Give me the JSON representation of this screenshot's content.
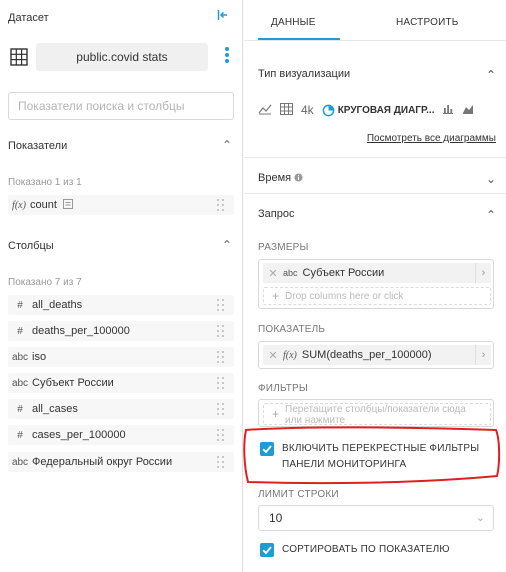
{
  "dataset": {
    "title": "Датасет",
    "name": "public.covid stats"
  },
  "search": {
    "placeholder": "Показатели поиска и столбцы"
  },
  "metrics_section": {
    "title": "Показатели",
    "count_text": "Показано 1 из 1",
    "items": [
      {
        "type": "f(x)",
        "label": "count"
      }
    ]
  },
  "columns_section": {
    "title": "Столбцы",
    "count_text": "Показано 7 из 7",
    "items": [
      {
        "type": "#",
        "label": "all_deaths"
      },
      {
        "type": "#",
        "label": "deaths_per_100000"
      },
      {
        "type": "abc",
        "label": "iso"
      },
      {
        "type": "abc",
        "label": "Субъект России"
      },
      {
        "type": "#",
        "label": "all_cases"
      },
      {
        "type": "#",
        "label": "cases_per_100000"
      },
      {
        "type": "abc",
        "label": "Федеральный округ России"
      }
    ]
  },
  "tabs": [
    {
      "label": "ДАННЫЕ",
      "active": true
    },
    {
      "label": "НАСТРОИТЬ",
      "active": false
    }
  ],
  "viz": {
    "title": "Тип визуализации",
    "big_number_label": "4k",
    "selected_label": "КРУГОВАЯ ДИАГР...",
    "view_all_link": "Посмотреть все диаграммы"
  },
  "time_section": {
    "title": "Время"
  },
  "query": {
    "title": "Запрос",
    "dimensions_label": "РАЗМЕРЫ",
    "dimension_chip": {
      "type": "abc",
      "label": "Субъект России"
    },
    "dimensions_dropzone": "Drop columns here or click",
    "metric_label": "ПОКАЗАТЕЛЬ",
    "metric_chip": {
      "type": "f(x)",
      "label": "SUM(deaths_per_100000)"
    },
    "filters_label": "ФИЛЬТРЫ",
    "filters_dropzone_line1": "Перетащите столбцы/показатели сюда",
    "filters_dropzone_line2": "или нажмите",
    "cross_filters_line1": "ВКЛЮЧИТЬ ПЕРЕКРЕСТНЫЕ ФИЛЬТРЫ",
    "cross_filters_line2": "ПАНЕЛИ МОНИТОРИНГА",
    "cross_filters_checked": true,
    "row_limit_label": "ЛИМИТ СТРОКИ",
    "row_limit_value": "10",
    "sort_by_metric_label": "СОРТИРОВАТЬ ПО ПОКАЗАТЕЛЮ",
    "sort_by_metric_checked": true
  },
  "colors": {
    "accent": "#1f9cd6",
    "annotation": "#e02020"
  }
}
